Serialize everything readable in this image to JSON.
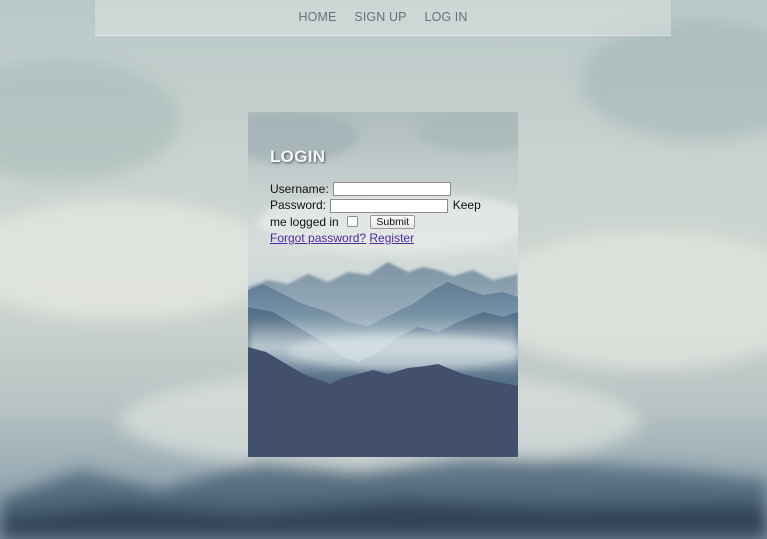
{
  "nav": {
    "items": [
      {
        "label": "HOME"
      },
      {
        "label": "SIGN UP"
      },
      {
        "label": "LOG IN"
      }
    ]
  },
  "login": {
    "title": "LOGIN",
    "username_label": "Username:",
    "username_value": "",
    "password_label": "Password:",
    "password_value": "",
    "keep_label_a": "Keep",
    "keep_label_b": "me logged in",
    "keep_checked": false,
    "submit_label": "Submit",
    "forgot_link": "Forgot password?",
    "register_link": "Register"
  },
  "colors": {
    "link": "#4f2aa0",
    "nav_text": "#6a7178",
    "panel_dark": "#43506d"
  }
}
